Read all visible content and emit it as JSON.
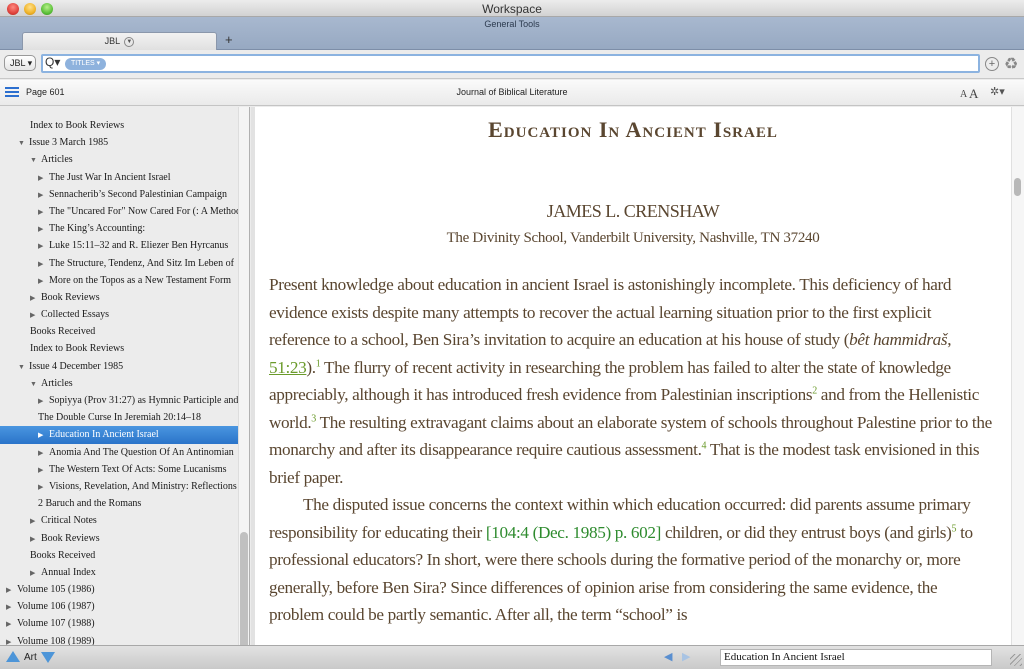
{
  "window": {
    "title": "Workspace",
    "subtitle": "General Tools"
  },
  "tabs": [
    {
      "label": "JBL",
      "active": true
    }
  ],
  "add_tab_label": "+",
  "search": {
    "library_button": "JBL ▾",
    "scope_pill": "TITLES ▾",
    "value": "",
    "search_icon": "Q▾",
    "add_icon": "+",
    "recycle_icon": "♻"
  },
  "infobar": {
    "page": "Page 601",
    "book_title": "Journal of Biblical Literature",
    "font_small": "A",
    "font_large": "A",
    "gear_icon": "✲▾"
  },
  "sidebar": {
    "items": [
      {
        "label": "Index to Book Reviews",
        "level": 1,
        "toggle": ""
      },
      {
        "label": "Issue 3 March 1985",
        "level": 0.5,
        "toggle": "▼"
      },
      {
        "label": "Articles",
        "level": 1,
        "toggle": "▼"
      },
      {
        "label": "The Just War In Ancient Israel",
        "level": 2,
        "toggle": "▶"
      },
      {
        "label": "Sennacherib’s Second Palestinian Campaign",
        "level": 2,
        "toggle": "▶"
      },
      {
        "label": "The \"Uncared For\" Now Cared For (: A Methodological",
        "level": 2,
        "toggle": "▶"
      },
      {
        "label": "The King’s Accounting:",
        "level": 2,
        "toggle": "▶"
      },
      {
        "label": "Luke 15:11–32 and R. Eliezer Ben Hyrcanus",
        "level": 2,
        "toggle": "▶"
      },
      {
        "label": "The Structure, Tendenz, And Sitz Im Leben of",
        "level": 2,
        "toggle": "▶"
      },
      {
        "label": "More on the Topos as a New Testament Form",
        "level": 2,
        "toggle": "▶"
      },
      {
        "label": "Book Reviews",
        "level": 1,
        "toggle": "▶"
      },
      {
        "label": "Collected Essays",
        "level": 1,
        "toggle": "▶"
      },
      {
        "label": "Books Received",
        "level": 1,
        "toggle": ""
      },
      {
        "label": "Index to Book Reviews",
        "level": 1,
        "toggle": ""
      },
      {
        "label": "Issue 4 December 1985",
        "level": 0.5,
        "toggle": "▼"
      },
      {
        "label": "Articles",
        "level": 1,
        "toggle": "▼"
      },
      {
        "label": "Sopiyya (Prov 31:27) as Hymnic Participle and",
        "level": 2,
        "toggle": "▶"
      },
      {
        "label": "The Double Curse In Jeremiah 20:14–18",
        "level": 2,
        "toggle": ""
      },
      {
        "label": "Education In Ancient Israel",
        "level": 2,
        "toggle": "▶",
        "selected": true
      },
      {
        "label": "Anomia And The Question Of An Antinomian",
        "level": 2,
        "toggle": "▶"
      },
      {
        "label": "The Western Text Of Acts: Some Lucanisms",
        "level": 2,
        "toggle": "▶"
      },
      {
        "label": "Visions, Revelation, And Ministry: Reflections",
        "level": 2,
        "toggle": "▶"
      },
      {
        "label": "2 Baruch and the Romans",
        "level": 2,
        "toggle": ""
      },
      {
        "label": "Critical Notes",
        "level": 1,
        "toggle": "▶"
      },
      {
        "label": "Book Reviews",
        "level": 1,
        "toggle": "▶"
      },
      {
        "label": "Books Received",
        "level": 1,
        "toggle": ""
      },
      {
        "label": "Annual Index",
        "level": 1,
        "toggle": "▶"
      },
      {
        "label": "Volume 105 (1986)",
        "level": 0,
        "toggle": "▶"
      },
      {
        "label": "Volume 106 (1987)",
        "level": 0,
        "toggle": "▶"
      },
      {
        "label": "Volume 107 (1988)",
        "level": 0,
        "toggle": "▶"
      },
      {
        "label": "Volume 108 (1989)",
        "level": 0,
        "toggle": "▶"
      }
    ]
  },
  "article": {
    "title": "Education In Ancient Israel",
    "author": "JAMES L. CRENSHAW",
    "affiliation": "The Divinity School, Vanderbilt University, Nashville, TN 37240",
    "p1": {
      "a": "Present knowledge about education in ancient Israel is astonishingly incomplete. This deficiency of hard evidence exists despite many attempts to recover the actual learning situation prior to the first explicit reference to a school, Ben Sira’s invitation to acquire an education at his house of study (",
      "italic": "bêt hammidraš",
      "b": ", ",
      "xref": "51:23",
      "c": ").",
      "fn1": "1",
      "d": " The flurry of recent activity in researching the problem has failed to alter the state of knowledge appreciably, although it has introduced fresh evidence from Palestinian inscriptions",
      "fn2": "2",
      "e": " and from the Hellenistic world.",
      "fn3": "3",
      "f": " The resulting extravagant claims about an elaborate system of schools throughout Palestine prior to the monarchy and after its disappearance require cautious assessment.",
      "fn4": "4",
      "g": " That is the modest task envisioned in this brief paper."
    },
    "p2": {
      "a": "The disputed issue concerns the context within which education occurred: did parents assume primary responsibility for educating their ",
      "pageref": "[104:4 (Dec. 1985) p. 602]",
      "b": " children, or did they entrust boys (and girls)",
      "fn5": "5",
      "c": " to professional educators? In short, were there schools during the formative period of the monarchy or, more generally, before Ben Sira? Since differences of opinion arise from considering the same evidence, the problem could be partly semantic. After all, the term “school” is"
    }
  },
  "bottom": {
    "art_label": "Art",
    "back_icon": "◀",
    "forward_icon": "▶",
    "location_value": "Education In Ancient Israel"
  },
  "colors": {
    "text_brown": "#5a4630",
    "footnote_green": "#6a9a2a",
    "pageref_green": "#2e8b2e",
    "selection_blue": "#2a73c9",
    "tabstrip_blue": "#9fb0c9"
  }
}
